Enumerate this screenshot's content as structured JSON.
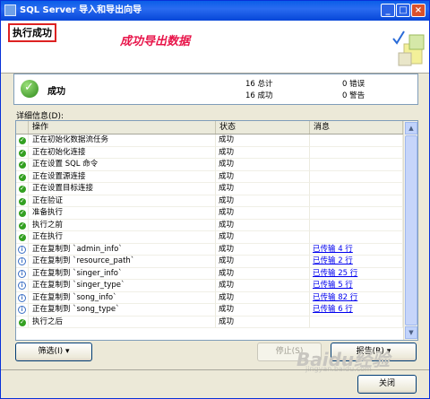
{
  "window": {
    "title": "SQL Server 导入和导出向导"
  },
  "header": {
    "title": "执行成功",
    "annotation": "成功导出数据"
  },
  "summary": {
    "status": "成功",
    "total_count": "16",
    "total_label": "总计",
    "success_count": "16",
    "success_label": "成功",
    "error_count": "0",
    "error_label": "错误",
    "warning_count": "0",
    "warning_label": "警告"
  },
  "details": {
    "label": "详细信息(D):",
    "columns": [
      "操作",
      "状态",
      "消息"
    ],
    "rows": [
      {
        "icon": "success-icon",
        "action": "正在初始化数据流任务",
        "status": "成功",
        "message": ""
      },
      {
        "icon": "success-icon",
        "action": "正在初始化连接",
        "status": "成功",
        "message": ""
      },
      {
        "icon": "success-icon",
        "action": "正在设置 SQL 命令",
        "status": "成功",
        "message": ""
      },
      {
        "icon": "success-icon",
        "action": "正在设置源连接",
        "status": "成功",
        "message": ""
      },
      {
        "icon": "success-icon",
        "action": "正在设置目标连接",
        "status": "成功",
        "message": ""
      },
      {
        "icon": "success-icon",
        "action": "正在验证",
        "status": "成功",
        "message": ""
      },
      {
        "icon": "success-icon",
        "action": "准备执行",
        "status": "成功",
        "message": ""
      },
      {
        "icon": "success-icon",
        "action": "执行之前",
        "status": "成功",
        "message": ""
      },
      {
        "icon": "success-icon",
        "action": "正在执行",
        "status": "成功",
        "message": ""
      },
      {
        "icon": "info-icon",
        "action": "正在复制到 `admin_info`",
        "status": "成功",
        "message": "已传输 4 行"
      },
      {
        "icon": "info-icon",
        "action": "正在复制到 `resource_path`",
        "status": "成功",
        "message": "已传输 2 行"
      },
      {
        "icon": "info-icon",
        "action": "正在复制到 `singer_info`",
        "status": "成功",
        "message": "已传输 25 行"
      },
      {
        "icon": "info-icon",
        "action": "正在复制到 `singer_type`",
        "status": "成功",
        "message": "已传输 5 行"
      },
      {
        "icon": "info-icon",
        "action": "正在复制到 `song_info`",
        "status": "成功",
        "message": "已传输 82 行"
      },
      {
        "icon": "info-icon",
        "action": "正在复制到 `song_type`",
        "status": "成功",
        "message": "已传输 6 行"
      },
      {
        "icon": "success-icon",
        "action": "执行之后",
        "status": "成功",
        "message": ""
      }
    ]
  },
  "buttons": {
    "filter": "筛选(I)",
    "stop": "停止(S)",
    "report": "报告(R)",
    "close": "关闭"
  },
  "watermark": {
    "brand": "Baidu经验",
    "url": "jingyan.baidu.com"
  }
}
